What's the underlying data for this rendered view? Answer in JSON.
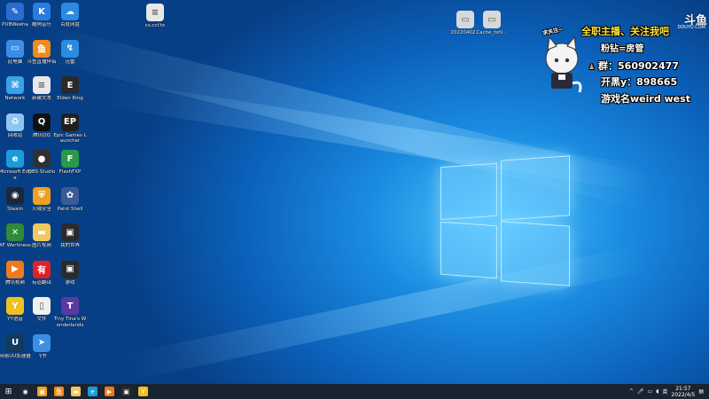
{
  "desktop": {
    "icons_col1": [
      {
        "label": "PUBWeeha",
        "icon": "tool-icon",
        "color": "#2a6bd1",
        "glyph": "✎"
      },
      {
        "label": "此电脑",
        "icon": "computer-icon",
        "color": "#3a8ee6",
        "glyph": "▭"
      },
      {
        "label": "Network",
        "icon": "network-icon",
        "color": "#3aa2e6",
        "glyph": "⌘"
      },
      {
        "label": "回收站",
        "icon": "recycle-bin-icon",
        "color": "#8fc5ef",
        "glyph": "♻"
      },
      {
        "label": "Microsoft Edge",
        "icon": "edge-icon",
        "color": "#1d9bd8",
        "glyph": "e"
      },
      {
        "label": "Steam",
        "icon": "steam-icon",
        "color": "#1b2838",
        "glyph": "◉"
      },
      {
        "label": "XF Wertiness",
        "icon": "xbox-icon",
        "color": "#2f8a3a",
        "glyph": "✕"
      },
      {
        "label": "腾讯视频",
        "icon": "video-icon",
        "color": "#f07a1a",
        "glyph": "▶"
      },
      {
        "label": "YY语音",
        "icon": "yy-icon",
        "color": "#f0c020",
        "glyph": "Y"
      },
      {
        "label": "网易UU加速器",
        "icon": "uu-icon",
        "color": "#123a5e",
        "glyph": "U"
      }
    ],
    "icons_col2": [
      {
        "label": "酷狗音乐",
        "icon": "kugou-icon",
        "color": "#2a7be0",
        "glyph": "K"
      },
      {
        "label": "斗鱼直播伴侣",
        "icon": "douyu-icon",
        "color": "#f08a1a",
        "glyph": "鱼"
      },
      {
        "label": "新建文本",
        "icon": "text-file-icon",
        "color": "#e8e8e8",
        "glyph": "≡"
      },
      {
        "label": "腾讯QQ",
        "icon": "qq-icon",
        "color": "#101010",
        "glyph": "Q"
      },
      {
        "label": "OBS Studio",
        "icon": "obs-icon",
        "color": "#303030",
        "glyph": "●"
      },
      {
        "label": "火绒安全",
        "icon": "shield-icon",
        "color": "#f0a020",
        "glyph": "⛨"
      },
      {
        "label": "图片视频",
        "icon": "folder-icon",
        "color": "#f0c860",
        "glyph": "▬"
      },
      {
        "label": "有道翻译",
        "icon": "youdao-icon",
        "color": "#e0202a",
        "glyph": "有"
      },
      {
        "label": "文件",
        "icon": "file-icon",
        "color": "#f0f0f0",
        "glyph": "▯"
      },
      {
        "label": "飞书",
        "icon": "feishu-icon",
        "color": "#3a8ee6",
        "glyph": "➤"
      }
    ],
    "icons_col3": [
      {
        "label": "百度网盘",
        "icon": "cloud-icon",
        "color": "#2a8be0",
        "glyph": "☁"
      },
      {
        "label": "迅雷",
        "icon": "thunder-icon",
        "color": "#2a8be0",
        "glyph": "↯"
      },
      {
        "label": "Elden Ring",
        "icon": "game-icon",
        "color": "#2a2a2a",
        "glyph": "E"
      },
      {
        "label": "Epic Games Launcher",
        "icon": "epic-icon",
        "color": "#202020",
        "glyph": "EP"
      },
      {
        "label": "FlashFXP",
        "icon": "ftp-icon",
        "color": "#2a9a4a",
        "glyph": "F"
      },
      {
        "label": "Paint Shell",
        "icon": "paint-icon",
        "color": "#3a5a9a",
        "glyph": "✿"
      },
      {
        "label": "我的世界",
        "icon": "game-icon",
        "color": "#2a2a2a",
        "glyph": "▣"
      },
      {
        "label": "游戏",
        "icon": "game-icon",
        "color": "#2a2a2a",
        "glyph": "▣"
      },
      {
        "label": "Tiny Tina's Wonderlands",
        "icon": "game-icon",
        "color": "#5a3aa0",
        "glyph": "T"
      }
    ],
    "top_icons": [
      {
        "label": "cs.ccf.tx",
        "icon": "text-file-icon",
        "color": "#e8e8e8",
        "glyph": "≡"
      },
      {
        "label": "20220402...",
        "icon": "image-icon",
        "color": "#d8d8d8",
        "glyph": "▭"
      },
      {
        "label": "Cache_tshl...",
        "icon": "image-icon",
        "color": "#d8d8d8",
        "glyph": "▭"
      }
    ]
  },
  "overlay": {
    "sticker": "求关注~",
    "banner": "全职主播、关注我吧",
    "brand": "斗鱼",
    "brand_sub": "DOUYU.COM",
    "line1": "粉钻=房管",
    "line2": "群：560902477",
    "line3": "开黑y：898665",
    "line4": "游戏名weird west"
  },
  "taskbar": {
    "apps": [
      {
        "name": "start-button",
        "color": "#1a2330",
        "glyph": "⊞"
      },
      {
        "name": "steam-taskbar-icon",
        "color": "#1b2838",
        "glyph": "◉"
      },
      {
        "name": "app-taskbar-icon",
        "color": "#f0a020",
        "glyph": "▣"
      },
      {
        "name": "douyu-taskbar-icon",
        "color": "#f08a1a",
        "glyph": "鱼"
      },
      {
        "name": "explorer-taskbar-icon",
        "color": "#f0c860",
        "glyph": "▬"
      },
      {
        "name": "edge-taskbar-icon",
        "color": "#1d9bd8",
        "glyph": "e"
      },
      {
        "name": "video-taskbar-icon",
        "color": "#f07a1a",
        "glyph": "▶"
      },
      {
        "name": "game-taskbar-icon",
        "color": "#2a2a2a",
        "glyph": "▣"
      },
      {
        "name": "yy-taskbar-icon",
        "color": "#f0c020",
        "glyph": "Y"
      }
    ],
    "time": "21:57",
    "date": "2022/4/5",
    "tray_lang": "英"
  }
}
